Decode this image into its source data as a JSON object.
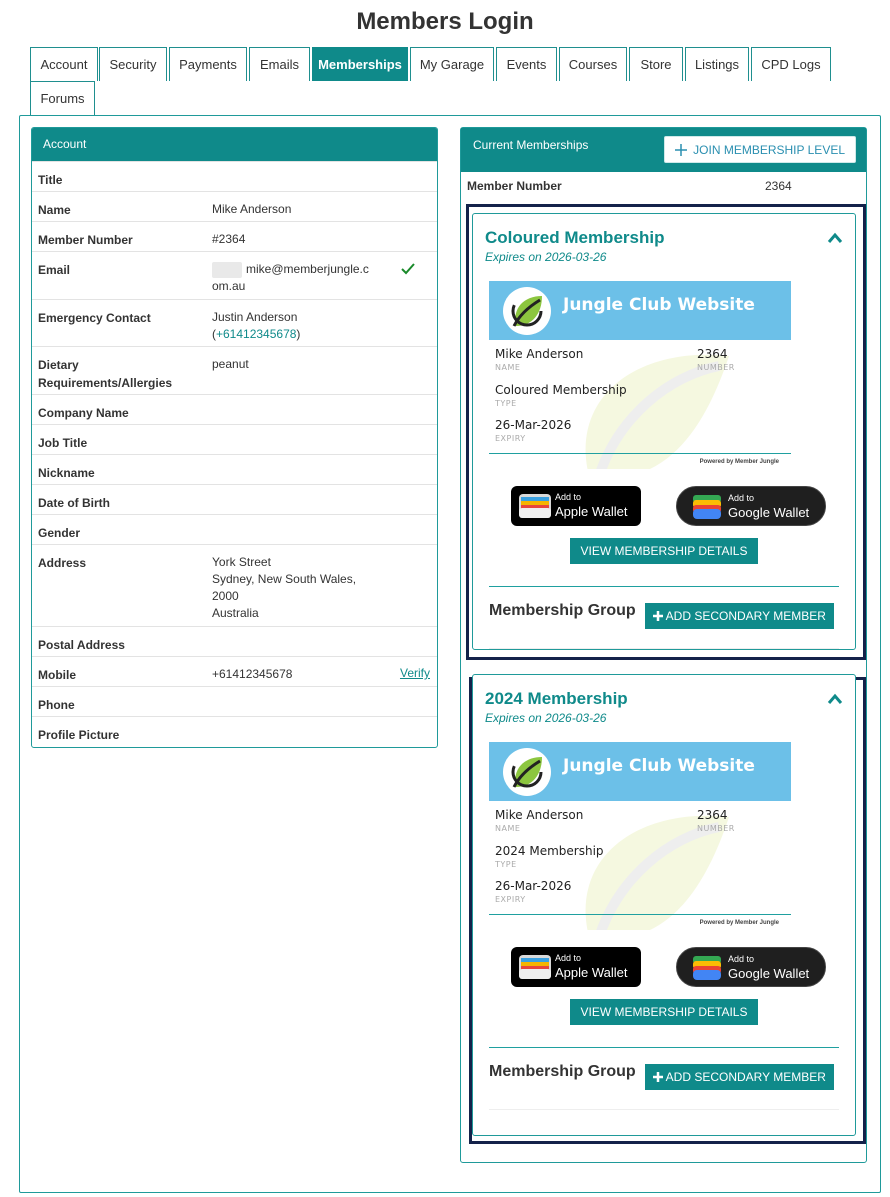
{
  "page": {
    "title": "Members Login"
  },
  "tabs": [
    "Account",
    "Security",
    "Payments",
    "Emails",
    "Memberships",
    "My Garage",
    "Events",
    "Courses",
    "Store",
    "Listings",
    "CPD Logs",
    "Forums"
  ],
  "account": {
    "heading": "Account",
    "rows": [
      {
        "label": "Title",
        "value": ""
      },
      {
        "label": "Name",
        "value": "Mike Anderson"
      },
      {
        "label": "Member Number",
        "value": "#2364"
      },
      {
        "label": "Email",
        "value": "mike@memberjungle.com.au"
      },
      {
        "label": "Emergency Contact",
        "value_name": "Justin Anderson",
        "value_phone": "+61412345678"
      },
      {
        "label": "Dietary Requirements/Allergies",
        "value": "peanut"
      },
      {
        "label": "Company Name",
        "value": ""
      },
      {
        "label": "Job Title",
        "value": ""
      },
      {
        "label": "Nickname",
        "value": ""
      },
      {
        "label": "Date of Birth",
        "value": ""
      },
      {
        "label": "Gender",
        "value": ""
      },
      {
        "label": "Address",
        "lines": [
          "York Street",
          "Sydney, New South Wales,",
          "2000",
          "Australia"
        ]
      },
      {
        "label": "Postal Address",
        "value": ""
      },
      {
        "label": "Mobile",
        "value": "+61412345678",
        "action": "Verify"
      },
      {
        "label": "Phone",
        "value": ""
      },
      {
        "label": "Profile Picture",
        "value": ""
      }
    ]
  },
  "memberships": {
    "heading": "Current Memberships",
    "join_label": "JOIN MEMBERSHIP LEVEL",
    "member_number_label": "Member Number",
    "member_number": "2364",
    "items": [
      {
        "name": "Coloured Membership",
        "expires": "Expires on 2026-03-26",
        "card": {
          "club": "Jungle Club Website",
          "holder": "Mike Anderson",
          "holder_label": "NAME",
          "number": "2364",
          "number_label": "NUMBER",
          "type": "Coloured Membership",
          "type_label": "TYPE",
          "expiry": "26-Mar-2026",
          "expiry_label": "EXPIRY",
          "powered": "Powered by Member Jungle"
        },
        "apple": {
          "small": "Add to",
          "big": "Apple Wallet"
        },
        "google": {
          "small": "Add to",
          "big": "Google Wallet"
        },
        "view_label": "VIEW MEMBERSHIP DETAILS",
        "group_label": "Membership Group",
        "add_secondary_label": "ADD SECONDARY MEMBER"
      },
      {
        "name": "2024 Membership",
        "expires": "Expires on 2026-03-26",
        "card": {
          "club": "Jungle Club Website",
          "holder": "Mike Anderson",
          "holder_label": "NAME",
          "number": "2364",
          "number_label": "NUMBER",
          "type": "2024 Membership",
          "type_label": "TYPE",
          "expiry": "26-Mar-2026",
          "expiry_label": "EXPIRY",
          "powered": "Powered by Member Jungle"
        },
        "apple": {
          "small": "Add to",
          "big": "Apple Wallet"
        },
        "google": {
          "small": "Add to",
          "big": "Google Wallet"
        },
        "view_label": "VIEW MEMBERSHIP DETAILS",
        "group_label": "Membership Group",
        "add_secondary_label": "ADD SECONDARY MEMBER"
      }
    ]
  },
  "colors": {
    "teal": "#0f8a8a",
    "card_band": "#6cc0e8",
    "highlight": "#14224a",
    "join_text": "#2a8fb0"
  }
}
